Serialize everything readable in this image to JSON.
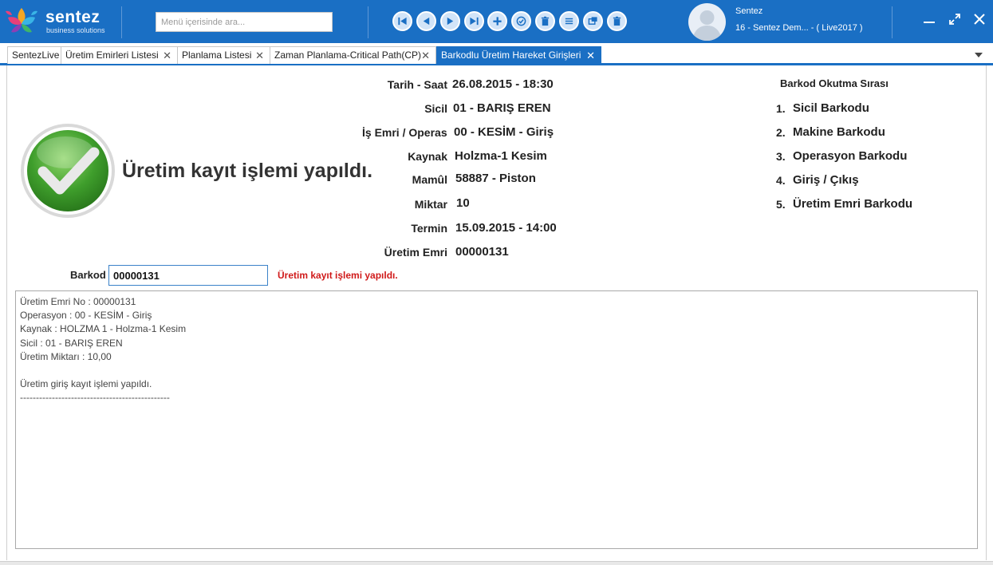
{
  "header": {
    "brand": "sentez",
    "brand_sub": "business solutions",
    "search_placeholder": "Menü içerisinde ara...",
    "user_name": "Sentez",
    "user_db": "16 - Sentez Dem... - ( Live2017 )",
    "toolbar_icons": [
      "first-icon",
      "prev-icon",
      "next-icon",
      "last-icon",
      "add-icon",
      "approve-icon",
      "delete-icon",
      "list-icon",
      "window-icon",
      "trash-icon"
    ]
  },
  "tabs": [
    {
      "label": "SentezLive",
      "closable": false
    },
    {
      "label": "Üretim Emirleri Listesi",
      "closable": true
    },
    {
      "label": "Planlama Listesi",
      "closable": true
    },
    {
      "label": "Zaman Planlama-Critical Path(CP)",
      "closable": true
    },
    {
      "label": "Barkodlu Üretim Hareket Girişleri",
      "closable": true
    }
  ],
  "colors": {
    "accent": "#1a6fc4",
    "error": "#d01a1a",
    "success": "#4caf3a"
  },
  "status": {
    "message": "Üretim kayıt işlemi yapıldı."
  },
  "details": {
    "tarih_label": "Tarih - Saat",
    "tarih_value": "26.08.2015 - 18:30",
    "sicil_label": "Sicil",
    "sicil_value": "01 - BARIŞ EREN",
    "isemri_label": "İş Emri / Operas",
    "isemri_value": "00 - KESİM - Giriş",
    "kaynak_label": "Kaynak",
    "kaynak_value": "Holzma-1 Kesim",
    "mamul_label": "Mamûl",
    "mamul_value": "58887 - Piston",
    "miktar_label": "Miktar",
    "miktar_value": "10",
    "termin_label": "Termin",
    "termin_value": "15.09.2015 - 14:00",
    "uretim_label": "Üretim Emri",
    "uretim_value": "00000131"
  },
  "steps": {
    "title": "Barkod Okutma Sırası",
    "items": [
      {
        "n": "1.",
        "text": "Sicil Barkodu"
      },
      {
        "n": "2.",
        "text": "Makine Barkodu"
      },
      {
        "n": "3.",
        "text": "Operasyon Barkodu"
      },
      {
        "n": "4.",
        "text": "Giriş / Çıkış"
      },
      {
        "n": "5.",
        "text": "Üretim Emri Barkodu"
      }
    ]
  },
  "barcode": {
    "label": "Barkod",
    "value": "00000131",
    "message": "Üretim kayıt işlemi yapıldı."
  },
  "log": {
    "lines": [
      "Üretim Emri No : 00000131",
      "Operasyon : 00 - KESİM - Giriş",
      "Kaynak : HOLZMA 1 - Holzma-1 Kesim",
      "Sicil : 01 - BARIŞ EREN",
      "Üretim Miktarı : 10,00",
      "",
      "Üretim giriş kayıt işlemi yapıldı.",
      "-----------------------------------------------"
    ]
  }
}
